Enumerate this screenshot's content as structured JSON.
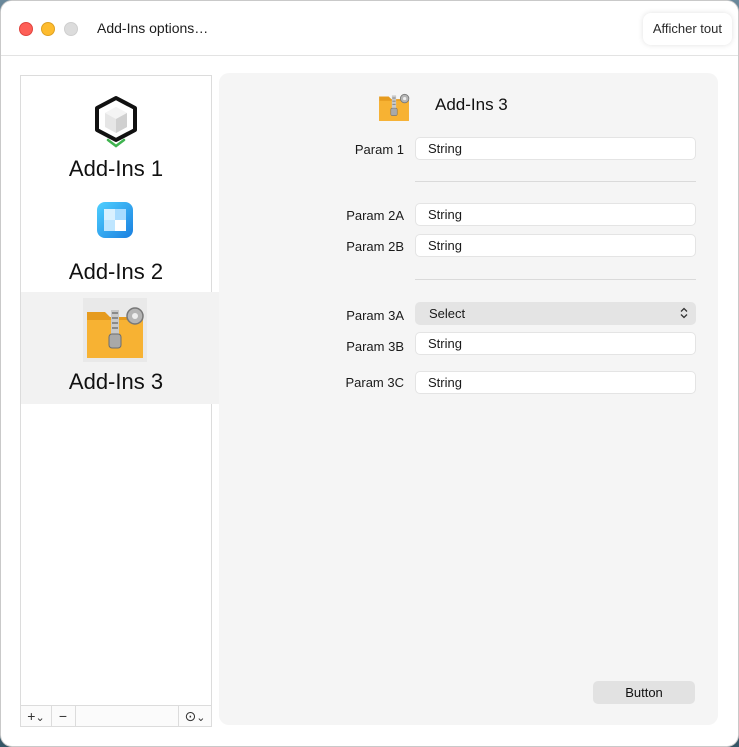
{
  "window": {
    "title": "Add-Ins options…",
    "show_all_label": "Afficher tout"
  },
  "sidebar": {
    "items": [
      {
        "label": "Add-Ins 1",
        "icon": "cube-icon",
        "selected": false
      },
      {
        "label": "Add-Ins 2",
        "icon": "blue-app-icon",
        "selected": false
      },
      {
        "label": "Add-Ins 3",
        "icon": "zip-folder-icon",
        "selected": true
      }
    ],
    "footer": {
      "add_label": "+",
      "add_chevron": "⌄",
      "remove_label": "−",
      "more_label": "⊙",
      "more_chevron": "⌄"
    }
  },
  "panel": {
    "title": "Add-Ins 3",
    "rows": {
      "param1": {
        "label": "Param 1",
        "value": "String"
      },
      "param2a": {
        "label": "Param 2A",
        "value": "String"
      },
      "param2b": {
        "label": "Param 2B",
        "value": "String"
      },
      "param3a": {
        "label": "Param 3A",
        "value": "Select"
      },
      "param3b": {
        "label": "Param 3B",
        "value": "String"
      },
      "param3c": {
        "label": "Param 3C",
        "value": "String"
      }
    },
    "button_label": "Button"
  },
  "colors": {
    "close": "#fe5f57",
    "minimize": "#febc2e",
    "zoom_disabled": "#dcdcdc",
    "panel_bg": "#f5f5f5"
  }
}
